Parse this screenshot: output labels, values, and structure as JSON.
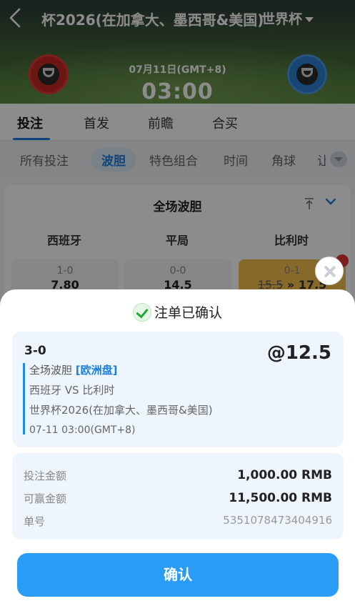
{
  "header": {
    "match_title": "杯2026(在加拿大、墨西哥&美国)",
    "league_select": "世界杯",
    "date": "07月11日(GMT+8)",
    "time": "03:00"
  },
  "main_tabs": [
    "投注",
    "首发",
    "前瞻",
    "合买"
  ],
  "sub_tabs": [
    "所有投注",
    "波胆",
    "特色组合",
    "时间",
    "角球",
    "让"
  ],
  "market": {
    "title": "全场波胆",
    "columns": [
      "西班牙",
      "平局",
      "比利时"
    ],
    "cells": [
      {
        "score": "1-0",
        "price": "7.80"
      },
      {
        "score": "0-0",
        "price": "14.5"
      },
      {
        "score": "0-1",
        "price_from": "15.5",
        "arrow": "»",
        "price": "17.5"
      }
    ]
  },
  "sheet": {
    "title": "注单已确认",
    "slip": {
      "score": "3-0",
      "odds": "@12.5",
      "market": "全场波胆",
      "market_tag": "[欧洲盘]",
      "teams": "西班牙 VS 比利时",
      "league": "世界杯2026(在加拿大、墨西哥&美国)",
      "kickoff": "07-11 03:00(GMT+8)"
    },
    "amounts": {
      "stake_label": "投注金额",
      "stake_value": "1,000.00 RMB",
      "payout_label": "可赢金额",
      "payout_value": "11,500.00 RMB",
      "ticket_label": "单号",
      "ticket_value": "5351078473404916"
    },
    "confirm_label": "确认"
  },
  "colors": {
    "accent": "#2a9cf5",
    "selected_cell": "#f6c04d",
    "success": "#22a833"
  }
}
